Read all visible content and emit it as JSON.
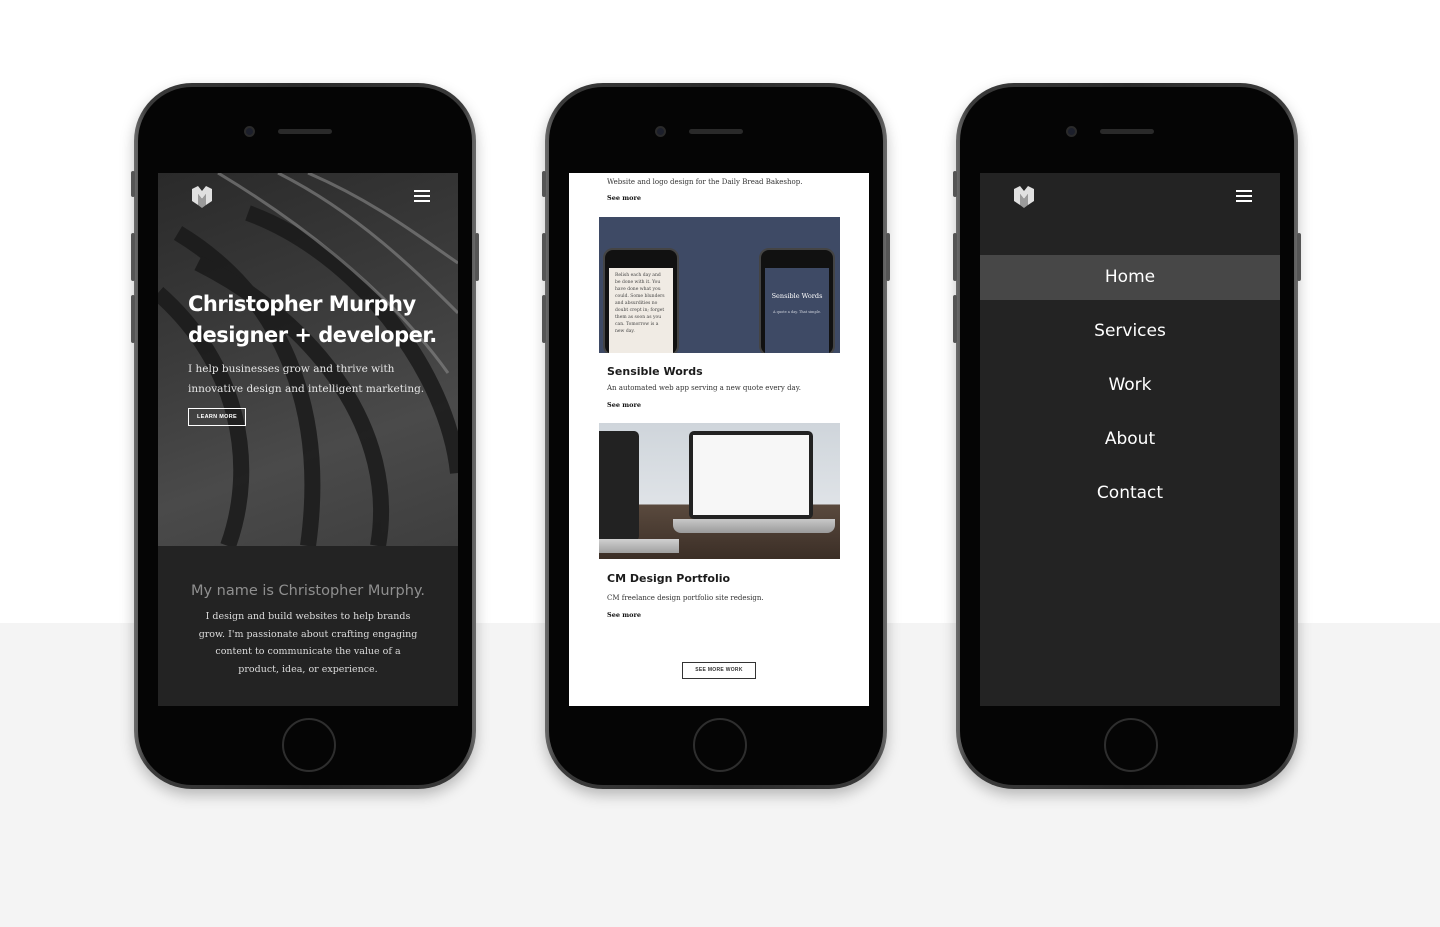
{
  "screen1": {
    "hero_title": "Christopher Murphy designer + developer.",
    "hero_text": "I help businesses grow and thrive with innovative design and intelligent marketing.",
    "learn_more": "LEARN MORE",
    "about_title": "My name is Christopher Murphy.",
    "about_text": "I design and build websites to help brands grow. I'm passionate about crafting engaging content to communicate the value of a product, idea, or experience."
  },
  "screen2": {
    "top_desc": "Website and logo design for the Daily Bread Bakeshop.",
    "see_more": "See more",
    "projects": [
      {
        "title": "Sensible Words",
        "desc": "An automated web app serving a new quote every day.",
        "see_more": "See more",
        "preview_text": "Relish each day and be done with it. You have done what you could. Some blunders and absurdities no doubt crept in; forget them as soon as you can. Tomorrow is a new day.",
        "preview_title": "Sensible Words",
        "preview_sub": "A quote a day. That simple."
      },
      {
        "title": "CM Design Portfolio",
        "desc": "CM freelance design portfolio site redesign.",
        "see_more": "See more"
      }
    ],
    "see_more_work": "SEE MORE WORK"
  },
  "screen3": {
    "menu": [
      "Home",
      "Services",
      "Work",
      "About",
      "Contact"
    ],
    "active": "Home"
  },
  "colors": {
    "dark_bg": "#232323",
    "menu_active": "#474747",
    "project_blue": "#3e4a65",
    "floor": "#f4f4f4"
  }
}
